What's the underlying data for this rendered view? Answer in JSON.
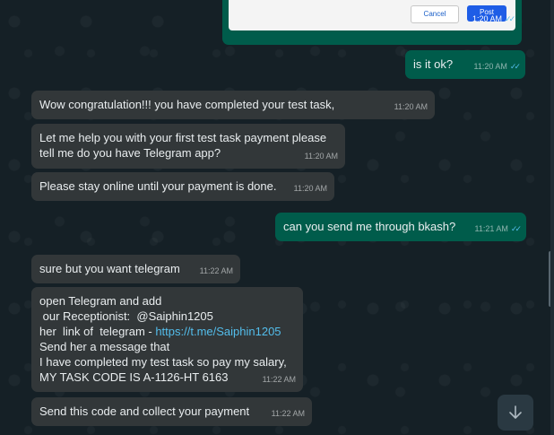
{
  "image_preview": {
    "cancel_label": "Cancel",
    "post_label": "Post",
    "time": "1:20 AM"
  },
  "messages": [
    {
      "text": "is it ok?",
      "time": "11:20 AM"
    },
    {
      "text": "Wow congratulation!!! you have completed your test task,",
      "time": "11:20 AM"
    },
    {
      "text": "Let me help you with your first test task payment please\ntell me do you have Telegram app?",
      "time": "11:20 AM"
    },
    {
      "text": "Please stay online until your payment is done.",
      "time": "11:20 AM"
    },
    {
      "text": "can you send me through bkash?",
      "time": "11:21 AM"
    },
    {
      "text": "sure but you want telegram",
      "time": "11:22 AM"
    },
    {
      "line1": "open Telegram and add",
      "line2": " our Receptionist:  @Saiphin1205",
      "line3_prefix": "her  link of  telegram - ",
      "line3_link": "https://t.me/Saiphin1205",
      "line4": "Send her a message that",
      "line5": "I have completed my test task so pay my salary,",
      "line6": "MY TASK CODE IS A-1126-HT 6163",
      "time": "11:22 AM"
    },
    {
      "text": "Send this code and collect your payment",
      "time": "11:22 AM"
    }
  ],
  "icons": {
    "read_ticks": "double-check",
    "scroll_down": "chevron-down"
  }
}
